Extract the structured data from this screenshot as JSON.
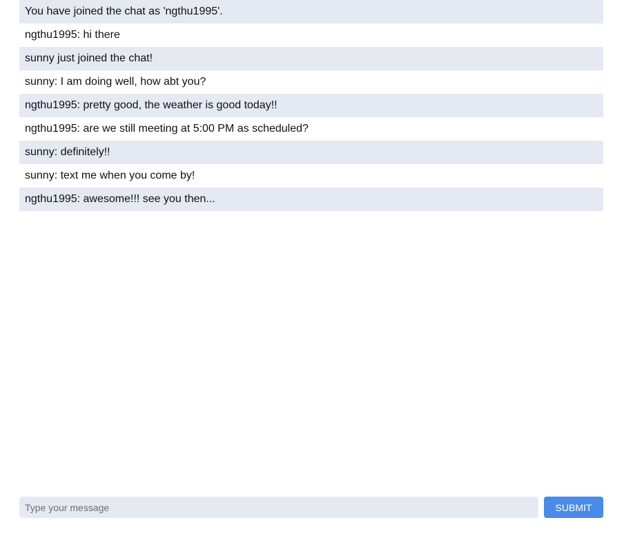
{
  "chat": {
    "messages": [
      "You have joined the chat as 'ngthu1995'.",
      "ngthu1995: hi there",
      "sunny just joined the chat!",
      "sunny: I am doing well, how abt you?",
      "ngthu1995: pretty good, the weather is good today!!",
      "ngthu1995: are we still meeting at 5:00 PM as scheduled?",
      "sunny: definitely!!",
      "sunny: text me when you come by!",
      "ngthu1995: awesome!!! see you then..."
    ]
  },
  "composer": {
    "placeholder": "Type your message",
    "value": "",
    "submit_label": "SUBMIT"
  },
  "colors": {
    "row_alt": "#e5e9f1",
    "accent": "#4a8ae8"
  }
}
